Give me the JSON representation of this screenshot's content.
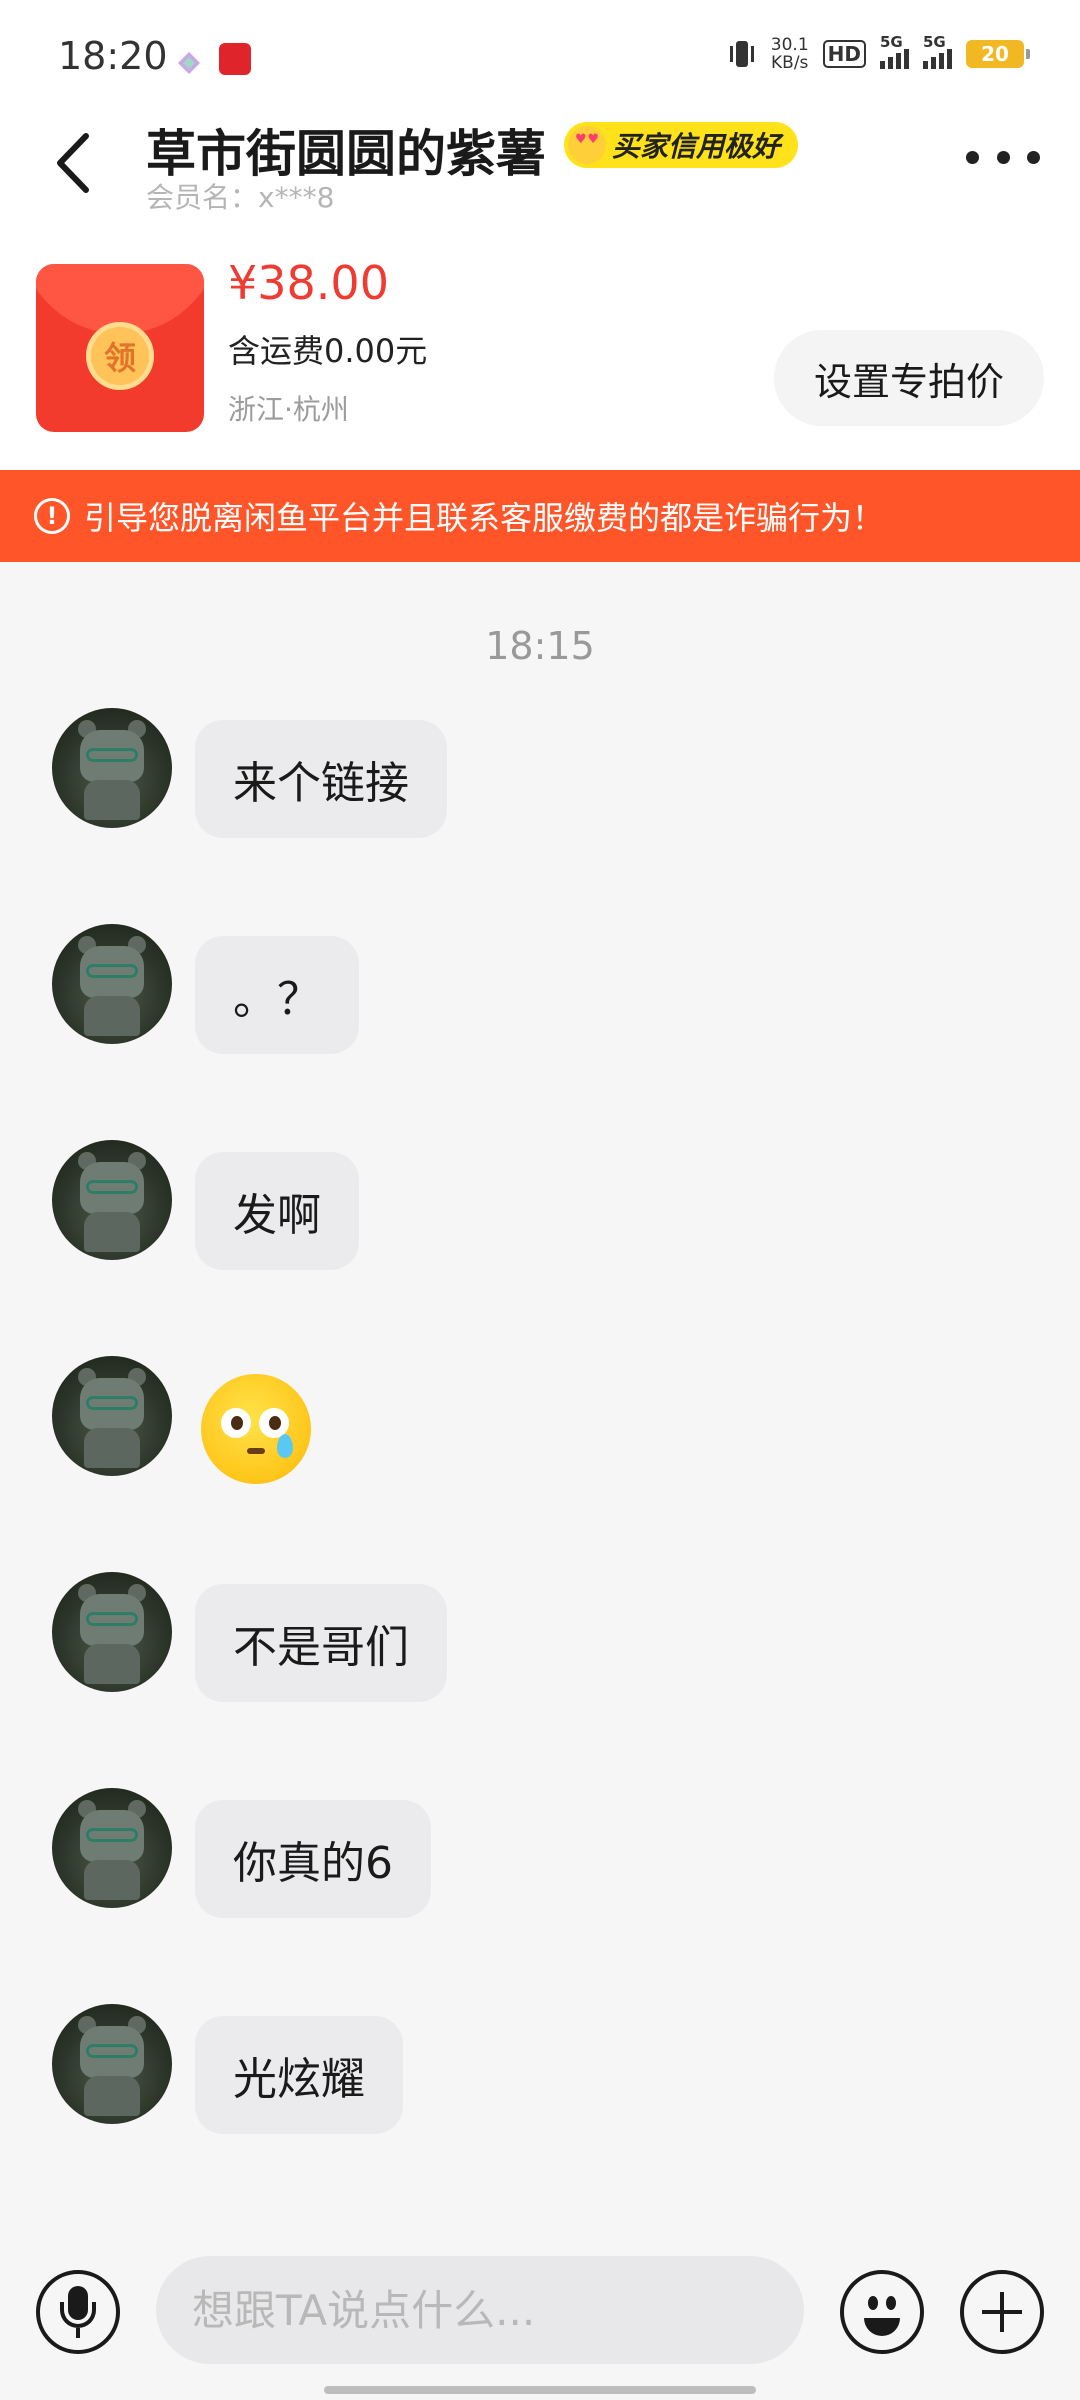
{
  "status_bar": {
    "time": "18:20",
    "net_speed_value": "30.1",
    "net_speed_unit": "KB/s",
    "hd_label": "HD",
    "network_1": "5G",
    "network_2": "5G",
    "battery": "20"
  },
  "header": {
    "title": "草市街圆圆的紫薯",
    "credit_badge": "买家信用极好",
    "member_name": "会员名：x***8"
  },
  "product": {
    "thumb_char": "领",
    "price": "¥38.00",
    "shipping": "含运费0.00元",
    "location": "浙江·杭州",
    "special_price_button": "设置专拍价"
  },
  "warning": {
    "icon": "!",
    "text": "引导您脱离闲鱼平台并且联系客服缴费的都是诈骗行为！"
  },
  "chat": {
    "time": "18:15",
    "messages": [
      {
        "type": "text",
        "text": "来个链接"
      },
      {
        "type": "text",
        "text": "。？"
      },
      {
        "type": "text",
        "text": "发啊"
      },
      {
        "type": "emoji",
        "icon": "crying-face-emoji"
      },
      {
        "type": "text",
        "text": "不是哥们"
      },
      {
        "type": "text",
        "text": "你真的6"
      },
      {
        "type": "text",
        "text": "光炫耀"
      }
    ]
  },
  "input_bar": {
    "placeholder": "想跟TA说点什么...",
    "value": ""
  },
  "colors": {
    "accent": "#ff5528",
    "price": "#ef3b32",
    "credit_badge": "#ffe21a"
  }
}
